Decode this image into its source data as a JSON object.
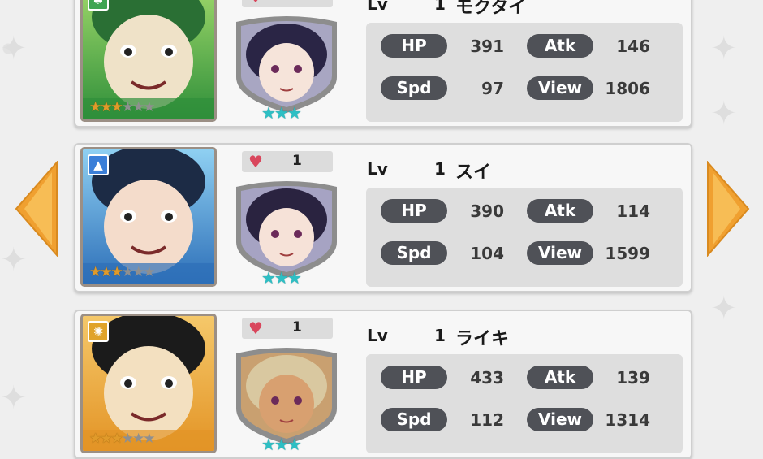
{
  "colors": {
    "pill": "#4f5157",
    "star_on": "#e09a2a",
    "star_off": "#8f8f8f",
    "rarity_star": "#2dbfc4",
    "heart": "#d9465c",
    "arrow": "#f0a030"
  },
  "cards": [
    {
      "lv_label": "Lv",
      "level": "1",
      "name": "モクタイ",
      "affection": "",
      "type_icon": "plant-icon",
      "type_color": "#3fa552",
      "stars": [
        true,
        true,
        true,
        false,
        false,
        false
      ],
      "rarity": "★★★",
      "stats": {
        "hp_label": "HP",
        "hp": "391",
        "atk_label": "Atk",
        "atk": "146",
        "spd_label": "Spd",
        "spd": "97",
        "view_label": "View",
        "view": "1806"
      }
    },
    {
      "lv_label": "Lv",
      "level": "1",
      "name": "スイ",
      "affection": "1",
      "type_icon": "water-drop-icon",
      "type_color": "#3b7fd8",
      "stars": [
        true,
        true,
        true,
        false,
        false,
        false
      ],
      "rarity": "★★★",
      "stats": {
        "hp_label": "HP",
        "hp": "390",
        "atk_label": "Atk",
        "atk": "114",
        "spd_label": "Spd",
        "spd": "104",
        "view_label": "View",
        "view": "1599"
      }
    },
    {
      "lv_label": "Lv",
      "level": "1",
      "name": "ライキ",
      "affection": "1",
      "type_icon": "sun-icon",
      "type_color": "#e0a32a",
      "stars": [
        true,
        true,
        true,
        false,
        false,
        false
      ],
      "rarity": "★★★",
      "stats": {
        "hp_label": "HP",
        "hp": "433",
        "atk_label": "Atk",
        "atk": "139",
        "spd_label": "Spd",
        "spd": "112",
        "view_label": "View",
        "view": "1314"
      }
    }
  ]
}
